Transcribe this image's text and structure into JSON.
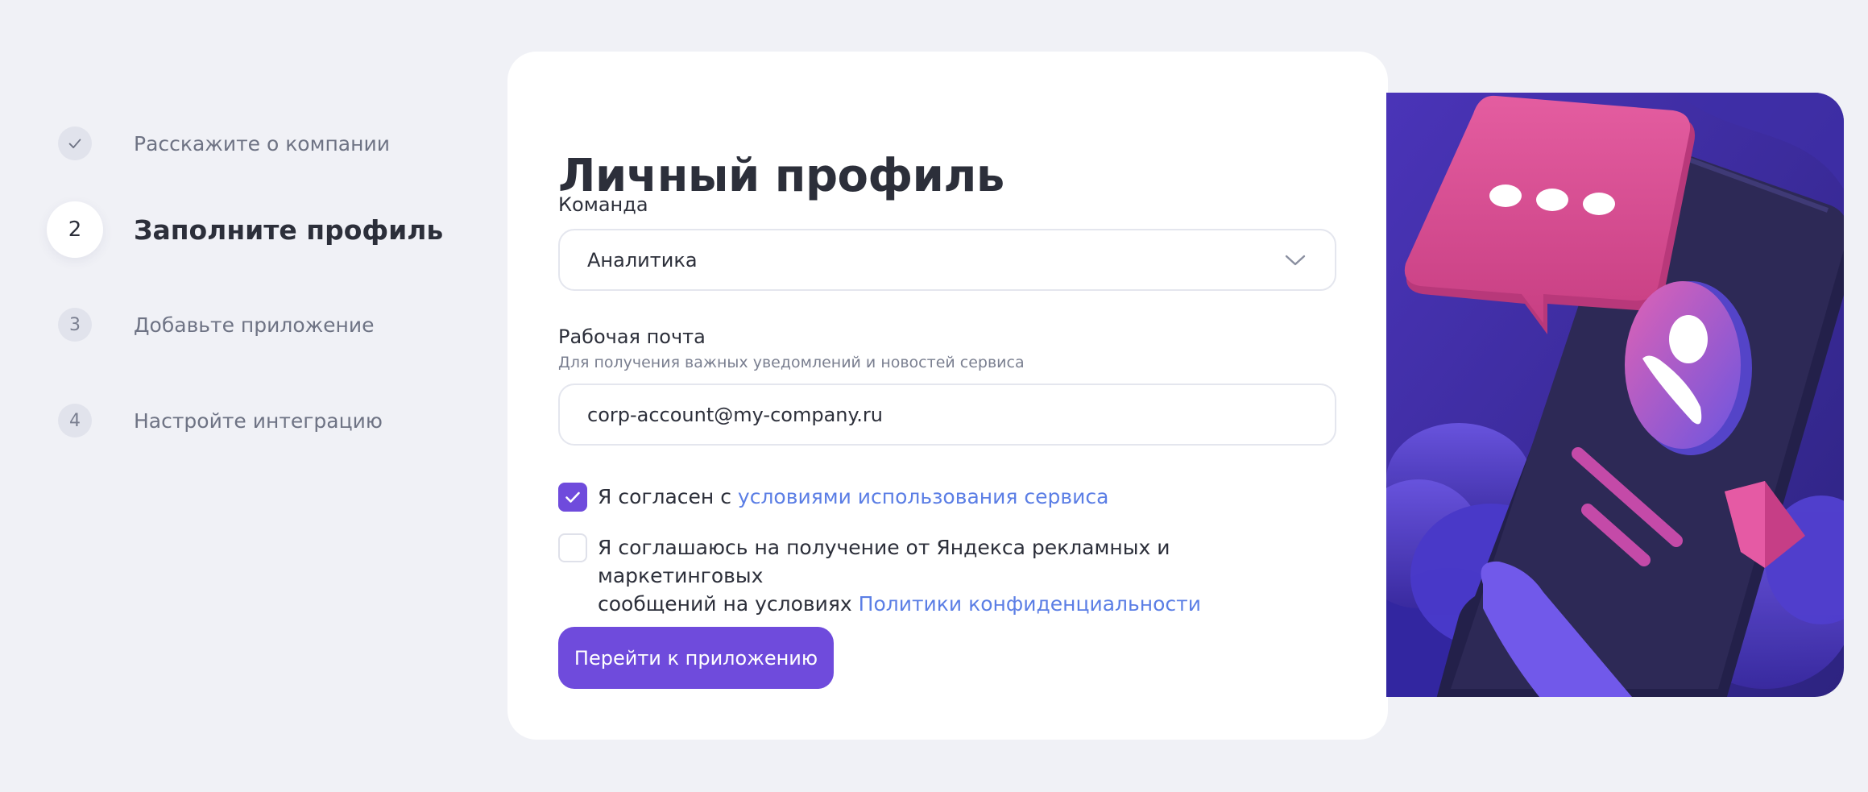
{
  "stepper": {
    "steps": [
      {
        "marker": "",
        "icon": "check-icon",
        "label": "Расскажите о компании",
        "state": "done"
      },
      {
        "marker": "2",
        "label": "Заполните профиль",
        "state": "active"
      },
      {
        "marker": "3",
        "label": "Добавьте приложение",
        "state": "pending"
      },
      {
        "marker": "4",
        "label": "Настройте интеграцию",
        "state": "pending"
      }
    ]
  },
  "form": {
    "title": "Личный профиль",
    "team": {
      "label": "Команда",
      "value": "Аналитика"
    },
    "email": {
      "label": "Рабочая почта",
      "hint": "Для получения важных уведомлений и новостей сервиса",
      "value": "corp-account@my-company.ru"
    },
    "agree_terms": {
      "checked": true,
      "text": "Я согласен с ",
      "link": "условиями использования сервиса"
    },
    "agree_marketing": {
      "checked": false,
      "text_line1": "Я соглашаюсь на получение от Яндекса рекламных и маркетинговых",
      "text_line2": "сообщений на условиях ",
      "link": "Политики конфиденциальности"
    },
    "submit_label": "Перейти к приложению"
  },
  "colors": {
    "accent": "#6f4bdc",
    "link": "#5b7ee5",
    "background": "#f0f1f6",
    "card": "#ffffff",
    "illustration_bg": "#3a2a9a",
    "bubble_pink": "#dd4f93"
  }
}
